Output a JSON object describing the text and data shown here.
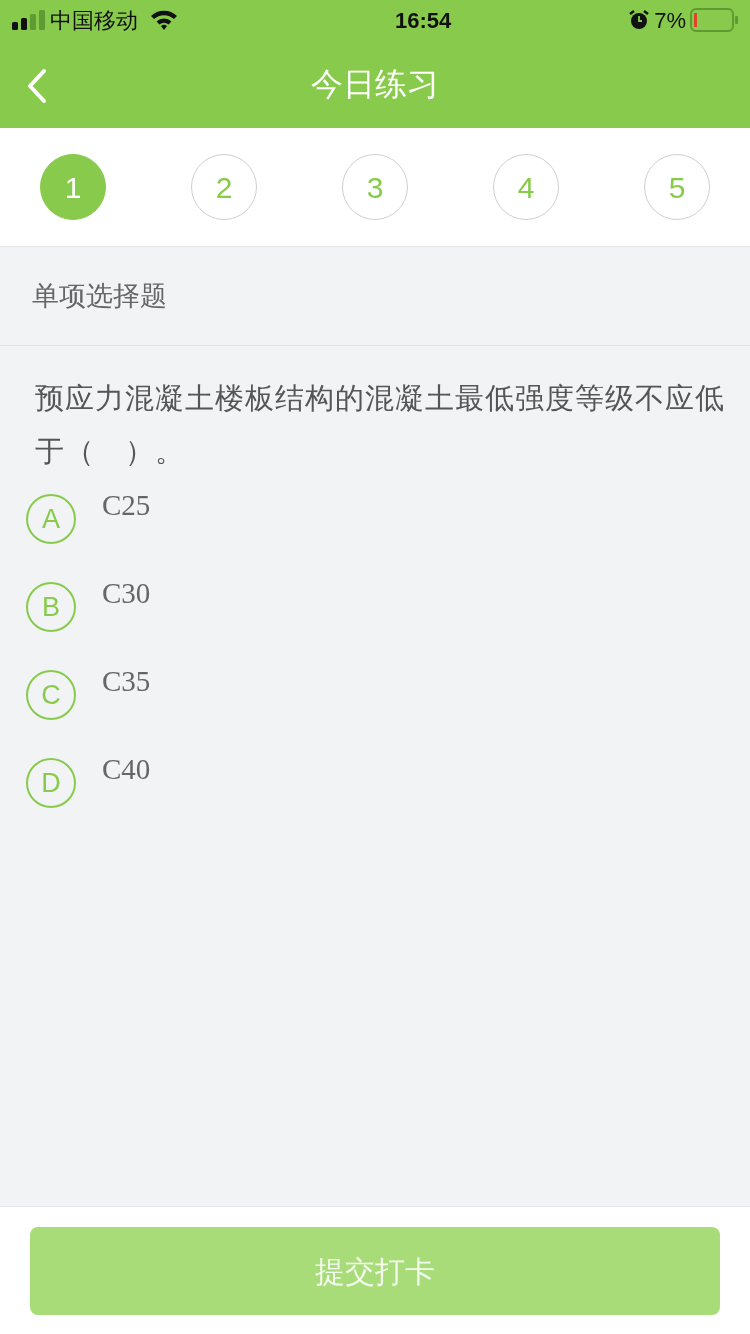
{
  "status_bar": {
    "carrier": "中国移动",
    "time": "16:54",
    "battery": "7%"
  },
  "nav": {
    "title": "今日练习"
  },
  "steps": [
    {
      "label": "1",
      "selected": true
    },
    {
      "label": "2",
      "selected": false
    },
    {
      "label": "3",
      "selected": false
    },
    {
      "label": "4",
      "selected": false
    },
    {
      "label": "5",
      "selected": false
    }
  ],
  "section": {
    "title": "单项选择题"
  },
  "question": {
    "text": "预应力混凝土楼板结构的混凝土最低强度等级不应低于（　）。"
  },
  "options": [
    {
      "letter": "A",
      "text": "C25",
      "selected": false
    },
    {
      "letter": "B",
      "text": "C30",
      "selected": false
    },
    {
      "letter": "C",
      "text": "C35",
      "selected": false
    },
    {
      "letter": "D",
      "text": "C40",
      "selected": false
    }
  ],
  "submit": {
    "label": "提交打卡",
    "disabled": true
  }
}
